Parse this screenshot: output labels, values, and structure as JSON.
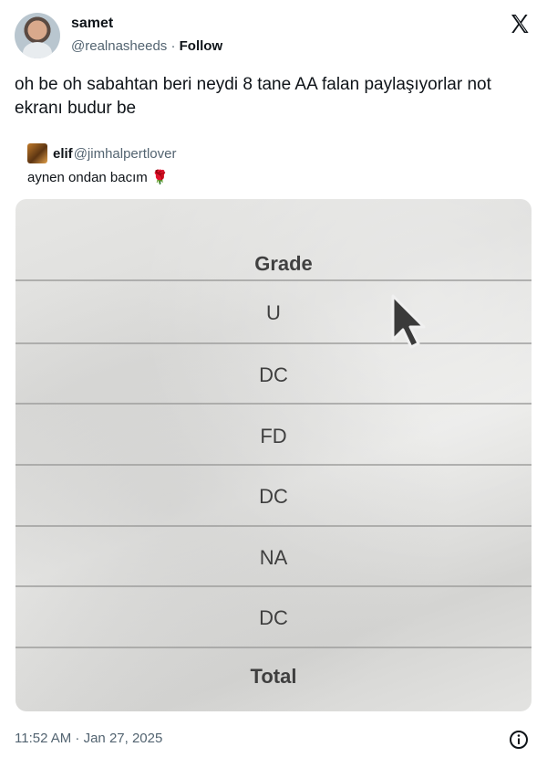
{
  "author": {
    "name": "samet",
    "handle": "@realnasheeds",
    "separator": " · ",
    "follow_label": "Follow"
  },
  "tweet_text": "oh be oh sabahtan beri neydi 8 tane AA falan paylaşıyorlar not ekranı budur be",
  "quote": {
    "name": "elif",
    "handle": "@jimhalpertlover",
    "text": "aynen ondan bacım",
    "emoji": "🌹"
  },
  "photo": {
    "header": "Grade",
    "grades": [
      "U",
      "DC",
      "FD",
      "DC",
      "NA",
      "DC"
    ],
    "footer": "Total"
  },
  "timestamp": "11:52 AM · Jan 27, 2025",
  "icons": {
    "logo": "x-logo-icon",
    "info": "info-icon",
    "cursor": "mouse-cursor-icon"
  }
}
